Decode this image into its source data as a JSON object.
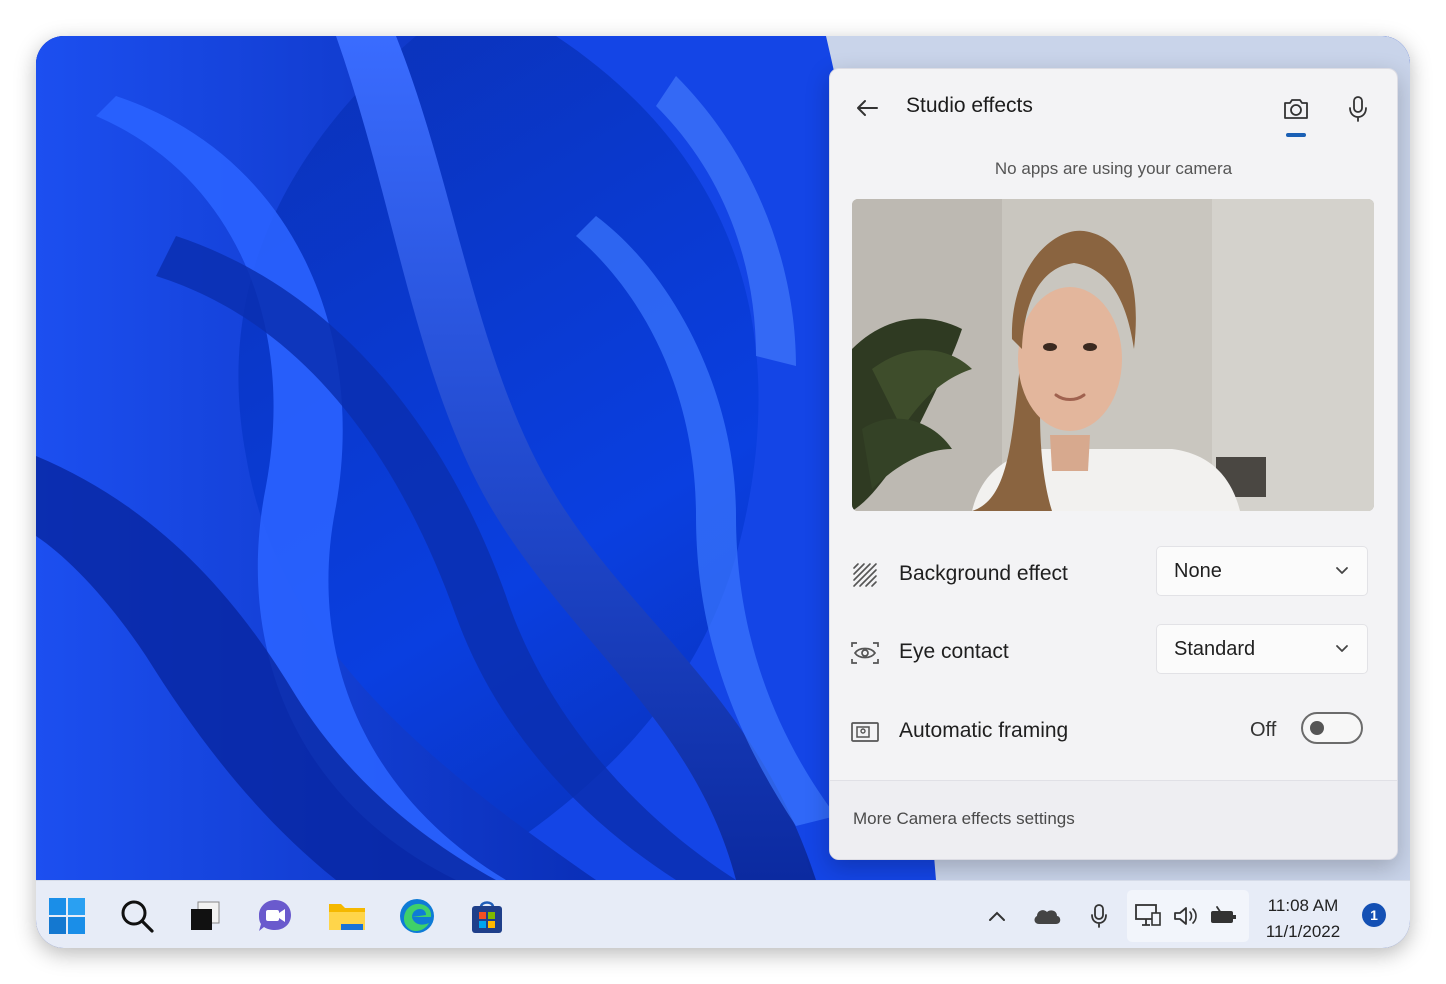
{
  "studio_panel": {
    "title": "Studio effects",
    "tabs": [
      {
        "name": "camera",
        "icon": "camera-icon",
        "selected": true
      },
      {
        "name": "microphone",
        "icon": "microphone-icon",
        "selected": false
      }
    ],
    "status_text": "No apps are using your camera",
    "settings": {
      "background_effect": {
        "label": "Background effect",
        "value": "None",
        "icon": "background-blur-icon"
      },
      "eye_contact": {
        "label": "Eye contact",
        "value": "Standard",
        "icon": "eye-contact-icon"
      },
      "automatic_framing": {
        "label": "Automatic framing",
        "state_label": "Off",
        "enabled": false,
        "icon": "framing-icon"
      }
    },
    "footer_link": "More Camera effects settings"
  },
  "taskbar": {
    "pinned_icons": [
      "windows-start-icon",
      "search-icon",
      "task-view-icon",
      "teams-chat-icon",
      "file-explorer-icon",
      "edge-browser-icon",
      "store-icon"
    ],
    "tray_icons": [
      "chevron-up-icon",
      "onedrive-cloud-icon",
      "microphone-in-use-icon",
      "network-icon",
      "volume-icon",
      "battery-icon"
    ],
    "time": "11:08 AM",
    "date": "11/1/2022",
    "notification_count": "1"
  },
  "colors": {
    "accent": "#1a5fb4",
    "wallpaper_blue": "#0a33c8",
    "panel_bg": "#f3f3f5",
    "taskbar_bg": "#e7ecf7"
  }
}
